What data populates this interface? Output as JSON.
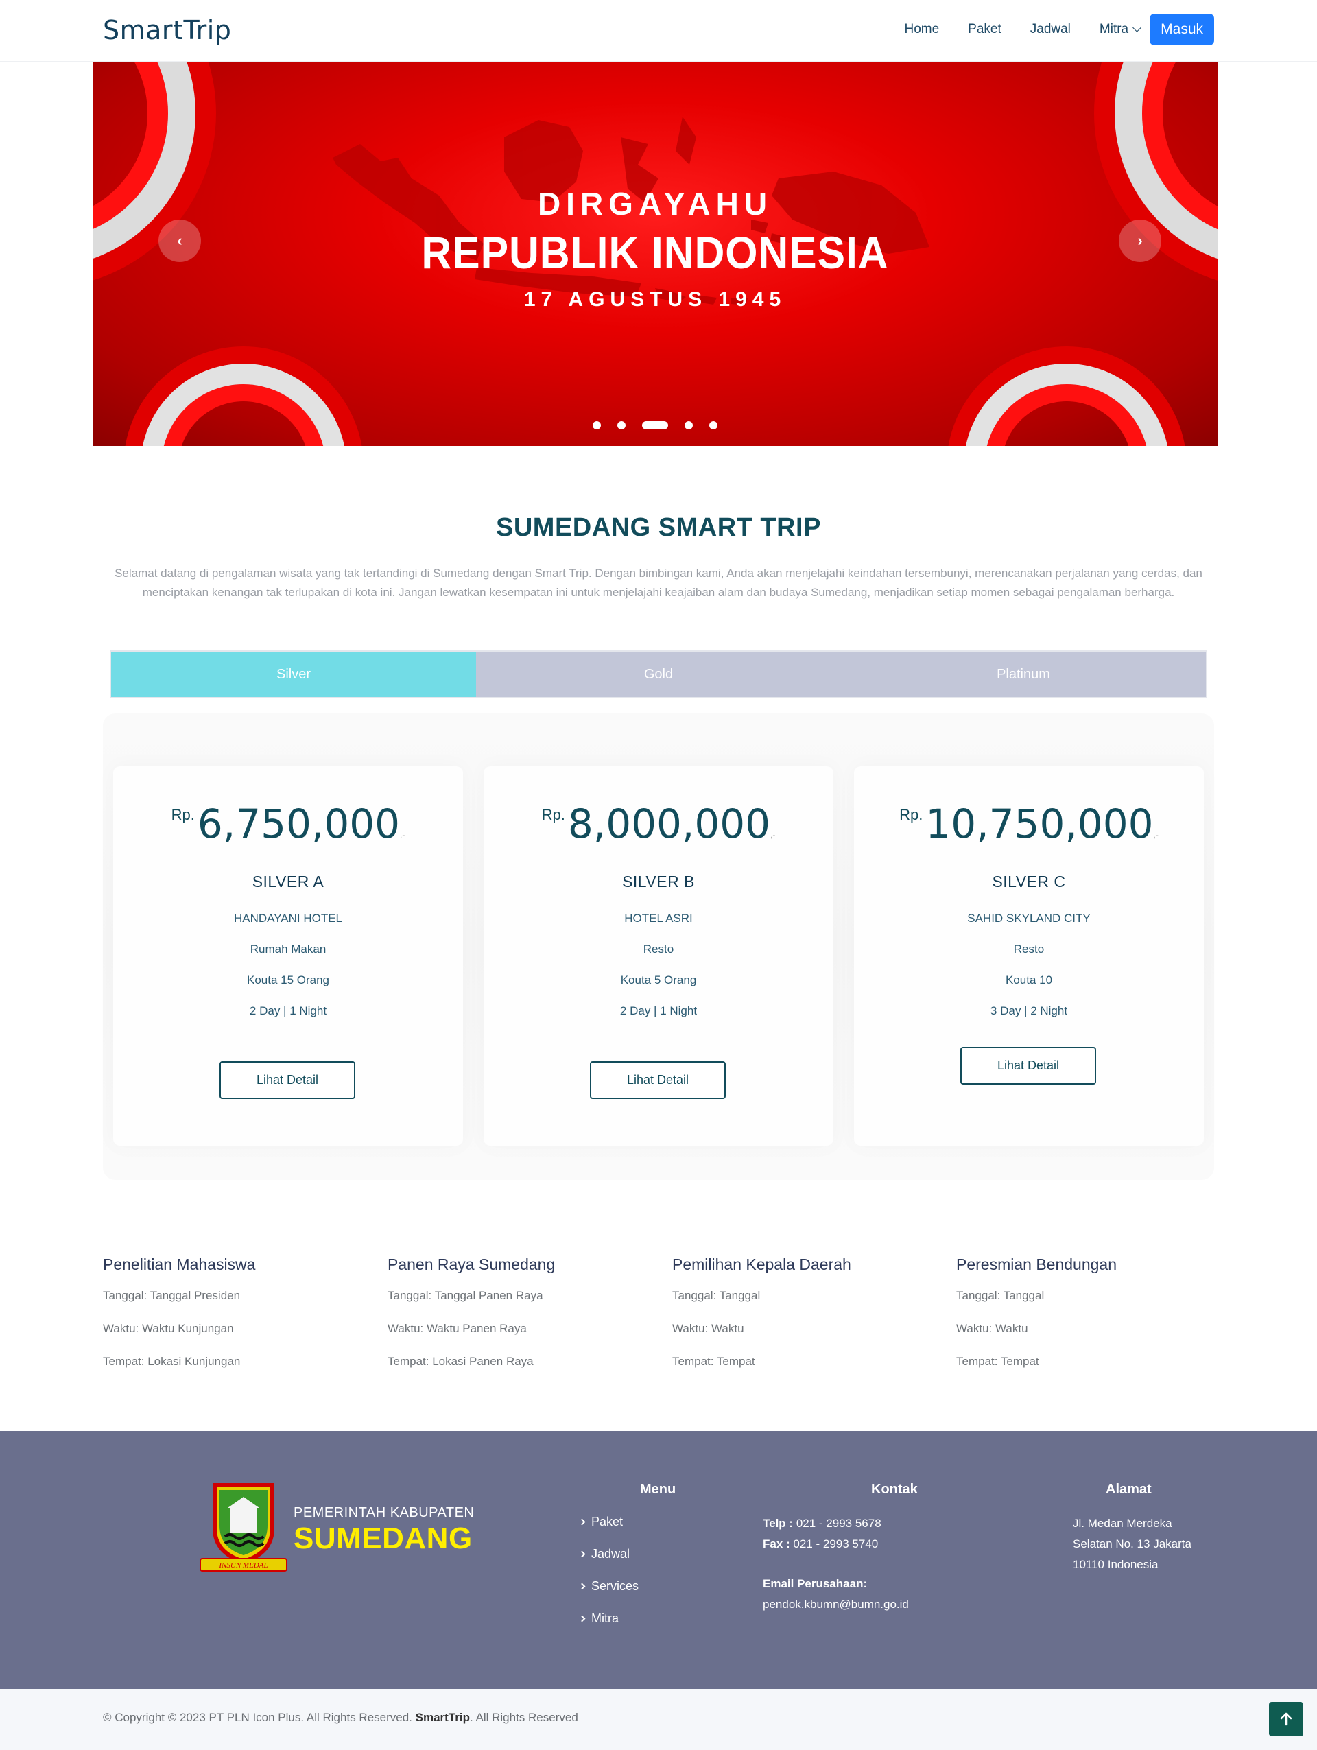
{
  "header": {
    "logo": "SmartTrip",
    "nav": [
      "Home",
      "Paket",
      "Jadwal",
      "Mitra"
    ],
    "login": "Masuk"
  },
  "hero": {
    "line1": "DIRGAYAHU",
    "line2": "REPUBLIK INDONESIA",
    "line3": "17 AGUSTUS 1945",
    "prev": "‹",
    "next": "›",
    "active_slide": 3,
    "slide_count": 5
  },
  "intro": {
    "title": "SUMEDANG SMART TRIP",
    "desc": "Selamat datang di pengalaman wisata yang tak tertandingi di Sumedang dengan Smart Trip. Dengan bimbingan kami, Anda akan menjelajahi keindahan tersembunyi, merencanakan perjalanan yang cerdas, dan menciptakan kenangan tak terlupakan di kota ini. Jangan lewatkan kesempatan ini untuk menjelajahi keajaiban alam dan budaya Sumedang, menjadikan setiap momen sebagai pengalaman berharga."
  },
  "tabs": [
    {
      "label": "Silver",
      "active": true
    },
    {
      "label": "Gold",
      "active": false
    },
    {
      "label": "Platinum",
      "active": false
    }
  ],
  "packages": [
    {
      "currency": "Rp.",
      "price": "6,750,000",
      "tail": ",-",
      "name": "SILVER A",
      "hotel": "HANDAYANI HOTEL",
      "food": "Rumah Makan",
      "quota": "Kouta 15 Orang",
      "duration": "2 Day | 1 Night",
      "button": "Lihat Detail"
    },
    {
      "currency": "Rp.",
      "price": "8,000,000",
      "tail": ",-",
      "name": "SILVER B",
      "hotel": "HOTEL ASRI",
      "food": "Resto",
      "quota": "Kouta 5 Orang",
      "duration": "2 Day | 1 Night",
      "button": "Lihat Detail"
    },
    {
      "currency": "Rp.",
      "price": "10,750,000",
      "tail": ",-",
      "name": "SILVER C",
      "hotel": "SAHID SKYLAND CITY",
      "food": "Resto",
      "quota": "Kouta 10",
      "duration": "3 Day | 2 Night",
      "button": "Lihat Detail"
    }
  ],
  "schedule": [
    {
      "title": "Penelitian Mahasiswa",
      "date": "Tanggal: Tanggal Presiden",
      "time": "Waktu: Waktu Kunjungan",
      "place": "Tempat: Lokasi Kunjungan"
    },
    {
      "title": "Panen Raya Sumedang",
      "date": "Tanggal: Tanggal Panen Raya",
      "time": "Waktu: Waktu Panen Raya",
      "place": "Tempat: Lokasi Panen Raya"
    },
    {
      "title": "Pemilihan Kepala Daerah",
      "date": "Tanggal: Tanggal",
      "time": "Waktu: Waktu",
      "place": "Tempat: Tempat"
    },
    {
      "title": "Peresmian Bendungan",
      "date": "Tanggal: Tanggal",
      "time": "Waktu: Waktu",
      "place": "Tempat: Tempat"
    }
  ],
  "footer": {
    "brand_line1": "PEMERINTAH KABUPATEN",
    "brand_line2": "SUMEDANG",
    "logo_motto": "INSUN MEDAL",
    "menu_title": "Menu",
    "menu": [
      "Paket",
      "Jadwal",
      "Services",
      "Mitra"
    ],
    "contact_title": "Kontak",
    "phone_label": "Telp :",
    "phone": "021 - 2993 5678",
    "fax_label": "Fax :",
    "fax": "021 - 2993 5740",
    "email_label": "Email Perusahaan:",
    "email": "pendok.kbumn@bumn.go.id",
    "address_title": "Alamat",
    "address_1": "Jl. Medan Merdeka",
    "address_2": "Selatan No. 13 Jakarta",
    "address_3": "10110 Indonesia",
    "copyright_pre": "© Copyright © 2023 PT PLN Icon Plus. All Rights Reserved.",
    "copyright_brand": "SmartTrip",
    "copyright_post": ". All Rights Reserved"
  },
  "colors": {
    "accent": "#1d7bff",
    "teal": "#124c5b",
    "tab_active": "#72dce6",
    "tab_inactive": "#c2c6d8",
    "footer_bg": "#6a6f8d",
    "hero_red": "#e60000"
  },
  "icons": {
    "nav_dropdown": "chevron-down-icon",
    "carousel_prev": "chevron-left-icon",
    "carousel_next": "chevron-right-icon",
    "footer_menu": "chevron-right-icon",
    "back_to_top": "arrow-up-icon"
  }
}
